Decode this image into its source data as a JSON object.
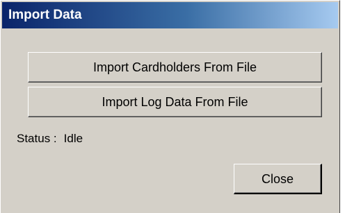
{
  "window": {
    "title": "Import Data"
  },
  "buttons": {
    "import_cardholders_label": "Import Cardholders From File",
    "import_log_data_label": "Import Log Data From File",
    "close_label": "Close"
  },
  "status": {
    "label": "Status :",
    "value": "Idle"
  },
  "colors": {
    "titlebar_start": "#0a246a",
    "titlebar_end": "#a6caf0",
    "dialog_face": "#d4d0c8"
  }
}
